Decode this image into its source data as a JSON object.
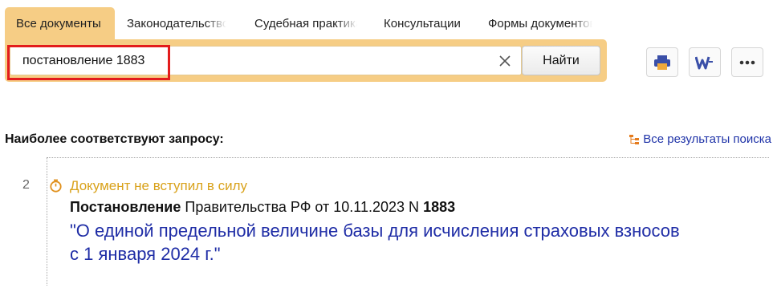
{
  "tabs": [
    {
      "label": "Все документы",
      "active": true
    },
    {
      "label": "Законодательство",
      "active": false
    },
    {
      "label": "Судебная практика",
      "active": false
    },
    {
      "label": "Консультации",
      "active": false
    },
    {
      "label": "Формы документов",
      "active": false
    }
  ],
  "search": {
    "value": "постановление 1883",
    "button_label": "Найти"
  },
  "toolbar": {
    "icons": [
      "print-icon",
      "word-export-icon",
      "more-icon"
    ]
  },
  "results": {
    "heading": "Наиболее соответствуют запросу:",
    "all_results_link": "Все результаты поиска",
    "items": [
      {
        "number": "2",
        "status": "Документ не вступил в силу",
        "doc_type": "Постановление",
        "issuer": "Правительства РФ от 10.11.2023 N",
        "doc_number": "1883",
        "title": "\"О единой предельной величине базы для исчисления страховых взносов с 1 января 2024 г.\""
      }
    ]
  },
  "colors": {
    "panel": "#f6cd85",
    "link": "#1f2da6",
    "status": "#d9a21b",
    "highlight": "#e31c1c"
  }
}
